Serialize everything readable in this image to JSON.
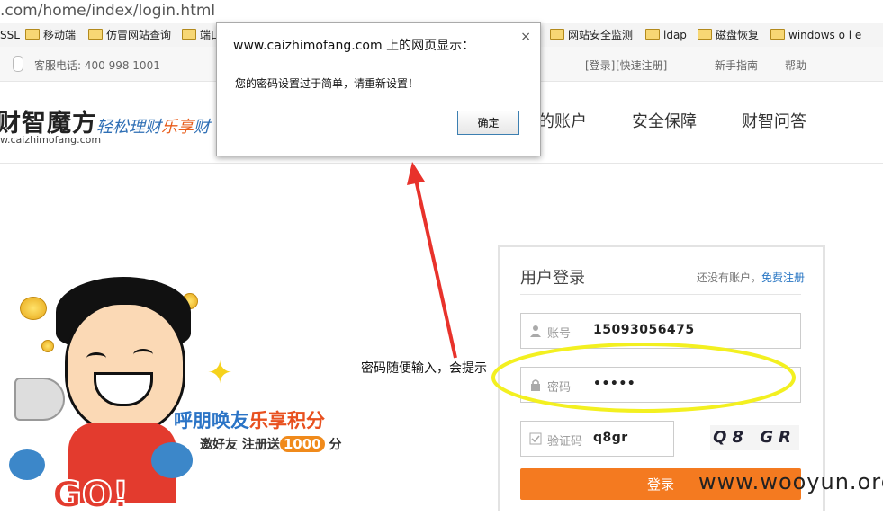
{
  "browser": {
    "url": ".com/home/index/login.html",
    "bookmarks": [
      {
        "label": "SSL",
        "folder": false
      },
      {
        "label": "移动端",
        "folder": true
      },
      {
        "label": "仿冒网站查询",
        "folder": true
      },
      {
        "label": "端口",
        "folder": true
      },
      {
        "label": "网站安全监测",
        "folder": true
      },
      {
        "label": "ldap",
        "folder": true
      },
      {
        "label": "磁盘恢复",
        "folder": true
      },
      {
        "label": "windows o l e",
        "folder": true
      }
    ]
  },
  "topbar": {
    "hotline": "客服电话: 400 998 1001",
    "login_link": "[登录]",
    "register_link": "[快速注册]",
    "guide": "新手指南",
    "help": "帮助"
  },
  "header": {
    "logo_text": "财智魔方",
    "logo_url": "w.caizhimofang.com",
    "slogan_a": "轻松理财",
    "slogan_b": "乐享",
    "slogan_c": "财",
    "nav": [
      "的账户",
      "安全保障",
      "财智问答"
    ]
  },
  "dialog": {
    "title": "www.caizhimofang.com 上的网页显示：",
    "close": "×",
    "message": "您的密码设置过于简单，请重新设置！",
    "ok_label": "确定"
  },
  "promo": {
    "line1_a": "呼朋唤友",
    "line1_b": "乐享积分",
    "line2_a": "邀好友 注册送",
    "line2_b": "1000",
    "line2_c": "分",
    "go": "GO!"
  },
  "login": {
    "title": "用户登录",
    "no_account": "还没有账户，",
    "register": "免费注册",
    "account_label": "账号",
    "account_value": "15093056475",
    "password_label": "密码",
    "password_value": "•••••",
    "captcha_label": "验证码",
    "captcha_value": "q8gr",
    "captcha_image_text": "Q8 GR",
    "submit": "登录"
  },
  "annotation": {
    "text": "密码随便输入，会提示",
    "arrow_color": "#e8322b",
    "ellipse_color": "#f3f020"
  },
  "watermark": "www.wooyun.org"
}
